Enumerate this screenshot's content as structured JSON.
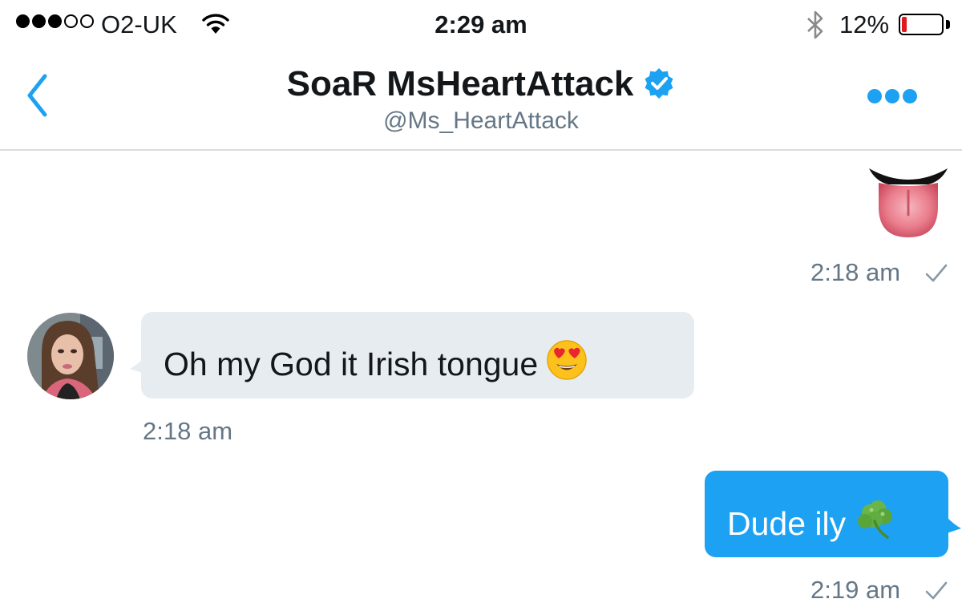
{
  "status_bar": {
    "carrier": "O2-UK",
    "time": "2:29 am",
    "battery_percent": "12%",
    "battery_level": 0.12,
    "signal_bars_filled": 3,
    "signal_bars_total": 5
  },
  "header": {
    "title": "SoaR MsHeartAttack",
    "handle": "@Ms_HeartAttack",
    "verified": true
  },
  "messages": [
    {
      "direction": "outgoing",
      "content": "tongue-emoji",
      "timestamp": "2:18 am",
      "read_receipt": "checkmark-icon"
    },
    {
      "direction": "incoming",
      "text": "Oh my God it Irish tongue",
      "emoji": "heart-eyes-emoji",
      "timestamp": "2:18 am"
    },
    {
      "direction": "outgoing",
      "text": "Dude ily",
      "emoji": "shamrock-emoji",
      "timestamp": "2:19 am",
      "read_receipt": "checkmark-icon"
    }
  ],
  "colors": {
    "accent": "#1da1f2",
    "incoming_bubble": "#e6ecf0",
    "secondary_text": "#657786",
    "battery_low": "#e0191f"
  }
}
